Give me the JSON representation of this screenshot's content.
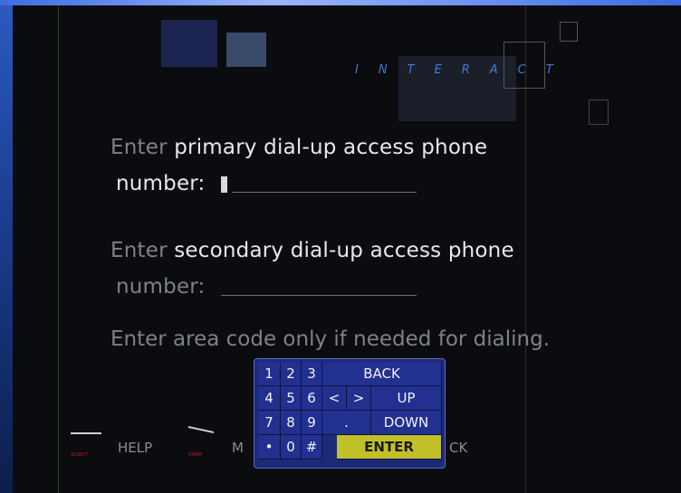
{
  "brand": "INTERACT",
  "form": {
    "primary": {
      "prefix": "Enter ",
      "highlight": "primary dial-up access phone",
      "suffix": "number:",
      "value": ""
    },
    "secondary": {
      "prefix": "Enter ",
      "highlight": "secondary dial-up access phone",
      "suffix": "number:",
      "value": ""
    },
    "note": "Enter area code only if needed for dialing."
  },
  "footer": {
    "help_label": "HELP",
    "menu_label": "M",
    "back_label": "CK",
    "select_tiny": "SELECT",
    "start_tiny": "START"
  },
  "keypad": {
    "rows": [
      [
        "1",
        "2",
        "3",
        "BACK"
      ],
      [
        "4",
        "5",
        "6",
        "<",
        ">",
        "UP"
      ],
      [
        "7",
        "8",
        "9",
        ".",
        "DOWN"
      ],
      [
        "•",
        "0",
        "#",
        "ENTER"
      ]
    ]
  }
}
